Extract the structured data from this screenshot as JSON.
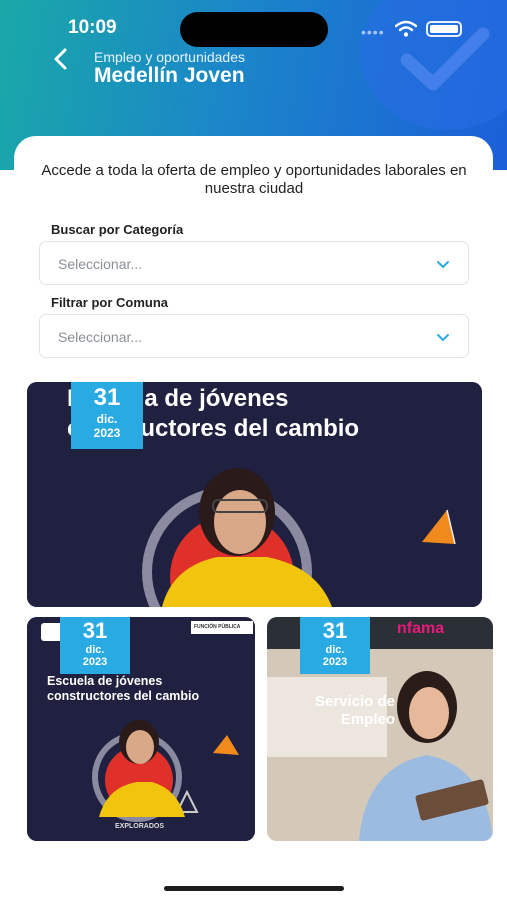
{
  "status_bar": {
    "time": "10:09",
    "dots": "••••"
  },
  "header": {
    "subtitle": "Empleo y oportunidades",
    "title": "Medellín Joven"
  },
  "intro_text": "Accede a toda la oferta de empleo y oportunidades laborales en nuestra ciudad",
  "filters": [
    {
      "label": "Buscar por Categoría",
      "placeholder": "Seleccionar..."
    },
    {
      "label": "Filtrar por Comuna",
      "placeholder": "Seleccionar..."
    }
  ],
  "cards": [
    {
      "day": "31",
      "month": "dic.",
      "year": "2023",
      "title_line1": "Escuela de jóvenes",
      "title_line2": "constructores del cambio"
    },
    {
      "day": "31",
      "month": "dic.",
      "year": "2023",
      "title_line1": "Escuela de jóvenes",
      "title_line2": "constructores del cambio",
      "corner_text": "FUNCIÓN PÚBLICA",
      "footer_text": "EXPLORADOS"
    },
    {
      "day": "31",
      "month": "dic.",
      "year": "2023",
      "brand": "nfama",
      "title_line1": "Servicio de",
      "title_line2": "Empleo"
    }
  ],
  "colors": {
    "accent": "#29aae3",
    "brand_pink": "#e8197a",
    "tile_dark": "#202040",
    "orange": "#f08a1c"
  }
}
